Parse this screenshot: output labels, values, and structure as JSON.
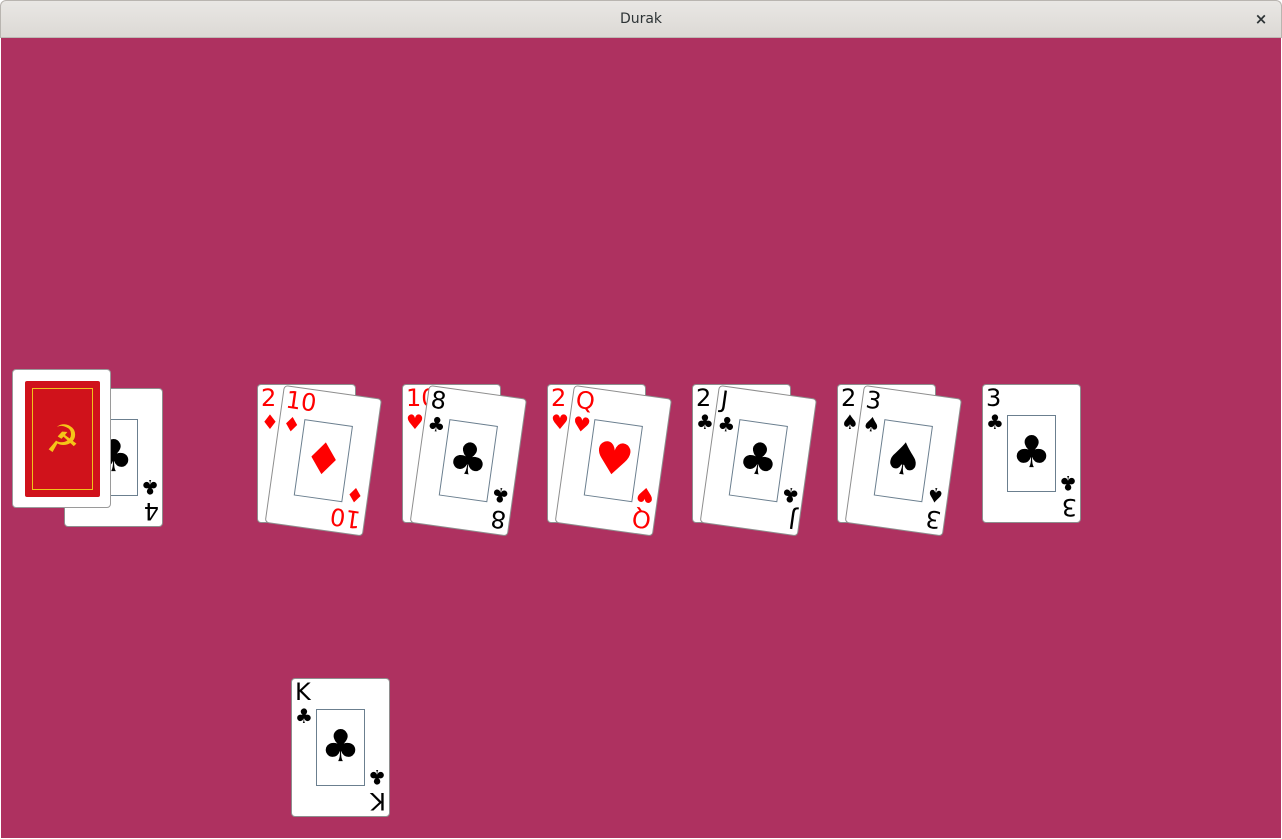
{
  "window": {
    "title": "Durak",
    "close_glyph": "×"
  },
  "colors": {
    "table": "#ae3160",
    "red_suit": "#ff0000",
    "black_suit": "#000000",
    "card_back": "#d0121b",
    "emblem": "#f5c518"
  },
  "deck": {
    "back_emblem": "☭",
    "back_icon": "hammer-and-sickle-icon"
  },
  "trump": {
    "rank": "4",
    "suit": "♣",
    "color": "black"
  },
  "table_pairs": [
    {
      "attack": {
        "rank": "2",
        "suit": "♦",
        "color": "red"
      },
      "defense": {
        "rank": "10",
        "suit": "♦",
        "color": "red"
      }
    },
    {
      "attack": {
        "rank": "10",
        "suit": "♥",
        "color": "red"
      },
      "defense": {
        "rank": "8",
        "suit": "♣",
        "color": "black"
      }
    },
    {
      "attack": {
        "rank": "2",
        "suit": "♥",
        "color": "red"
      },
      "defense": {
        "rank": "Q",
        "suit": "♥",
        "color": "red"
      }
    },
    {
      "attack": {
        "rank": "2",
        "suit": "♣",
        "color": "black"
      },
      "defense": {
        "rank": "J",
        "suit": "♣",
        "color": "black"
      }
    },
    {
      "attack": {
        "rank": "2",
        "suit": "♠",
        "color": "black"
      },
      "defense": {
        "rank": "3",
        "suit": "♠",
        "color": "black"
      }
    },
    {
      "attack": {
        "rank": "3",
        "suit": "♣",
        "color": "black"
      },
      "defense": null
    }
  ],
  "player_hand": [
    {
      "rank": "K",
      "suit": "♣",
      "color": "black"
    }
  ]
}
